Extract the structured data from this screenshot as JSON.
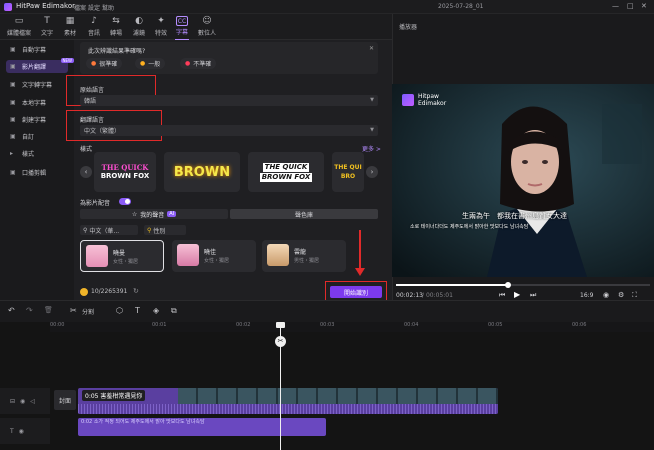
{
  "app": {
    "name": "HitPaw Edimakor",
    "menu": [
      "檔案",
      "設定",
      "幫助"
    ],
    "doc_title": "2025-07-28_01",
    "window_controls": [
      "—",
      "□",
      "✕"
    ]
  },
  "toolbar": [
    {
      "icon": "▭",
      "label": "媒體檔案"
    },
    {
      "icon": "T",
      "label": "文字"
    },
    {
      "icon": "▦",
      "label": "素材"
    },
    {
      "icon": "♪",
      "label": "音訊"
    },
    {
      "icon": "⇆",
      "label": "轉場"
    },
    {
      "icon": "◐",
      "label": "濾鏡"
    },
    {
      "icon": "✦",
      "label": "特效"
    },
    {
      "icon": "CC",
      "label": "字幕"
    },
    {
      "icon": "☺",
      "label": "數位人"
    }
  ],
  "sidebar": [
    {
      "icon": "▣",
      "label": "自動字幕"
    },
    {
      "icon": "▣",
      "label": "影片翻譯",
      "badge": "NEW"
    },
    {
      "icon": "▣",
      "label": "文字轉字幕"
    },
    {
      "icon": "▣",
      "label": "本地字幕"
    },
    {
      "icon": "▣",
      "label": "創建字幕"
    },
    {
      "icon": "▣",
      "label": "自訂"
    },
    {
      "icon": "▸",
      "label": "樣式"
    },
    {
      "icon": "▣",
      "label": "口播剪輯"
    }
  ],
  "panel": {
    "question": "此次辨識結果準確嗎?",
    "ratings": [
      {
        "emoji": "😊",
        "label": "很準確",
        "color": "#ff7a3c"
      },
      {
        "emoji": "🙂",
        "label": "一般",
        "color": "#ffb020"
      },
      {
        "emoji": "😞",
        "label": "不準確",
        "color": "#ff3c5a"
      }
    ],
    "source_lang_label": "原始語言",
    "source_lang_value": "韓語",
    "target_lang_label": "翻譯語言",
    "target_lang_value": "中文（繁體）",
    "style_label": "樣式",
    "more_link": "更多 >",
    "style_cards": [
      {
        "line1": "THE QUICK",
        "line2": "BROWN FOX"
      },
      {
        "line1": "BROWN",
        "line2": ""
      },
      {
        "line1": "THE QUICK",
        "line2": "BROWN FOX"
      },
      {
        "line1": "THE QUI",
        "line2": "BRO"
      }
    ],
    "dub_label": "為影片配音",
    "dub_toggle": true,
    "tab_my_voice": "我的聲音",
    "tab_ai_badge": "AI",
    "tab_clone": "聲色庫",
    "filter_lang": "中文（華...",
    "filter_gender": "性別",
    "voices": [
      {
        "name": "曉曼",
        "tags": "女性・獨居"
      },
      {
        "name": "曉佳",
        "tags": "女性・獨居"
      },
      {
        "name": "雲龍",
        "tags": "男性・獨居"
      }
    ],
    "credits": "10/2265391",
    "start_button": "開始識別"
  },
  "player": {
    "header": "播放器",
    "watermark": "Hitpaw\nEdimakor",
    "subtitle_zh": "生兩為午　都我在書州島質女大達",
    "subtitle_ko": "소로 테이너다더도 제주도에서 밝아한 맛보다도 남녀속담",
    "time_current": "00:02:13",
    "time_total": "00:05:01",
    "progress": 0.44,
    "aspect": "16:9",
    "controls": [
      "⏮",
      "▶",
      "⏭"
    ]
  },
  "timeline": {
    "tools": [
      "↶",
      "↷",
      "🗑",
      "✂",
      "分割",
      "⬡",
      "T",
      "◈",
      "⧉"
    ],
    "ticks": [
      "00:00",
      "00:01",
      "00:02",
      "00:03",
      "00:04",
      "00:05",
      "00:06"
    ],
    "cover_label": "封面",
    "clip_label": "0:05 害羞柑常遇見你",
    "subtitle_track_text": "0:02 소가 적정 되어도 제주도에서 밝아 맛보다도 남녀속담"
  },
  "colors": {
    "accent": "#8b5cf6",
    "highlight_box": "#e02a2a",
    "start_button": "#7c3aed"
  }
}
